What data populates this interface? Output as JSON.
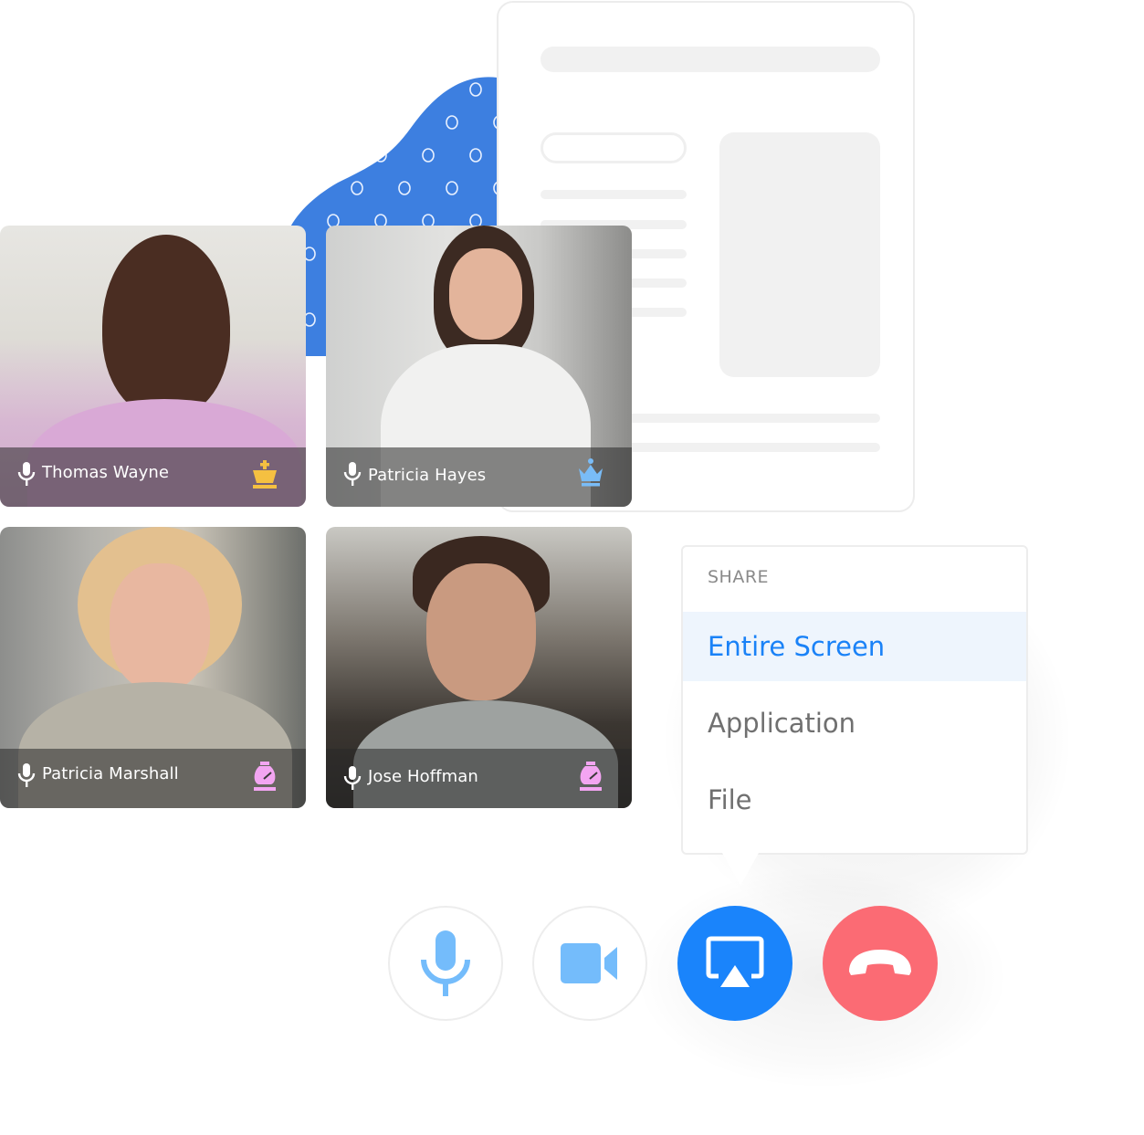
{
  "participants": [
    {
      "name": "Thomas Wayne",
      "role_icon": "king-icon",
      "role_color": "#f5c041"
    },
    {
      "name": "Patricia Hayes",
      "role_icon": "queen-icon",
      "role_color": "#79bcf7"
    },
    {
      "name": "Patricia Marshall",
      "role_icon": "bishop-icon",
      "role_color": "#f3a5f2"
    },
    {
      "name": "Jose Hoffman",
      "role_icon": "bishop-icon",
      "role_color": "#f3a5f2"
    }
  ],
  "share_menu": {
    "header": "SHARE",
    "items": [
      {
        "label": "Entire Screen",
        "selected": true
      },
      {
        "label": "Application",
        "selected": false
      },
      {
        "label": "File",
        "selected": false
      }
    ]
  },
  "controls": {
    "microphone": {
      "icon": "microphone-icon",
      "color": "#74bcfb"
    },
    "camera": {
      "icon": "video-camera-icon",
      "color": "#74bcfb"
    },
    "share_screen": {
      "icon": "screen-share-icon",
      "color": "#1a84fb",
      "active": true
    },
    "end_call": {
      "icon": "hang-up-icon",
      "color": "#fb6b74"
    }
  },
  "colors": {
    "accent": "#1a82f7",
    "blob": "#3d7fe0",
    "menu_selected_bg": "#eef5fd"
  }
}
